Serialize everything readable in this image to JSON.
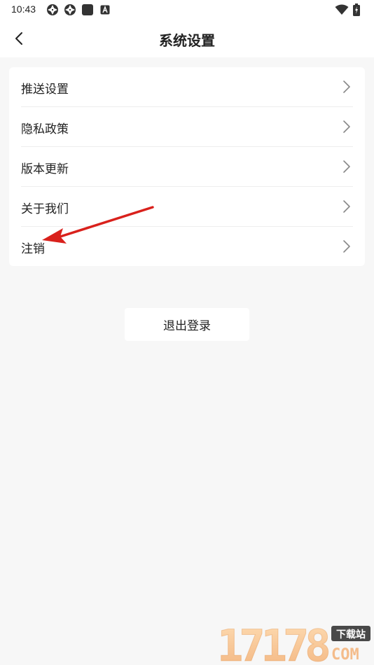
{
  "status_bar": {
    "time": "10:43",
    "left_icons": [
      "aperture-icon",
      "aperture-icon",
      "square-icon",
      "a-badge-icon"
    ],
    "right_icons": [
      "wifi-icon",
      "battery-icon"
    ]
  },
  "nav": {
    "back_icon": "chevron-left-icon",
    "title": "系统设置"
  },
  "settings": {
    "items": [
      {
        "label": "推送设置"
      },
      {
        "label": "隐私政策"
      },
      {
        "label": "版本更新"
      },
      {
        "label": "关于我们"
      },
      {
        "label": "注销"
      }
    ],
    "chevron_icon": "chevron-right-icon"
  },
  "logout": {
    "label": "退出登录"
  },
  "annotation": {
    "color": "#d9211c"
  },
  "watermark": {
    "digits": "17178",
    "badge": "下载站",
    "suffix": "COM"
  }
}
